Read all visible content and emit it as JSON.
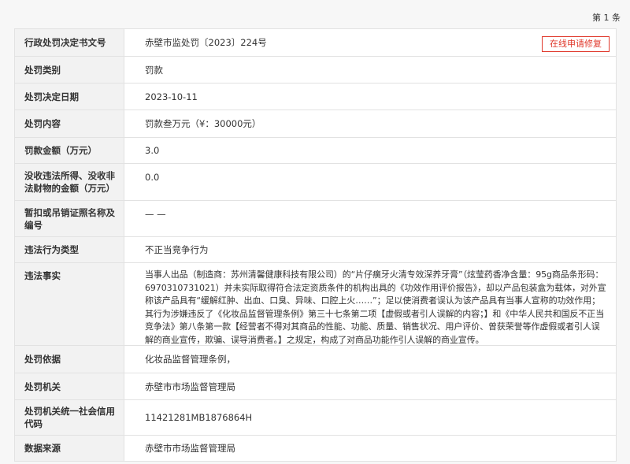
{
  "page_count": "第 1 条",
  "repair_button": "在线申请修复",
  "rows": [
    {
      "label": "行政处罚决定书文号",
      "value": "赤壁市监处罚〔2023〕224号"
    },
    {
      "label": "处罚类别",
      "value": "罚款"
    },
    {
      "label": "处罚决定日期",
      "value": "2023-10-11"
    },
    {
      "label": "处罚内容",
      "value": "罚款叁万元（¥：30000元）"
    },
    {
      "label": "罚款金额（万元）",
      "value": "3.0"
    },
    {
      "label": "没收违法所得、没收非法财物的金额（万元）",
      "value": "0.0"
    },
    {
      "label": "暂扣或吊销证照名称及编号",
      "value": "— —"
    },
    {
      "label": "违法行为类型",
      "value": "不正当竞争行为"
    },
    {
      "label": "违法事实",
      "value": "当事人出品（制造商：苏州清馨健康科技有限公司）的“片仔癀牙火清专效深养牙膏”（炫莹药香净含量：95g商品条形码：6970310731021）并未实际取得符合法定资质条件的机构出具的《功效作用评价报告》，却以产品包装盒为载体，对外宣称该产品具有“缓解红肿、出血、口臭、异味、口腔上火……”；足以使消费者误认为该产品具有当事人宣称的功效作用；其行为涉嫌违反了《化妆品监督管理条例》第三十七条第二项【虚假或者引人误解的内容；】和《中华人民共和国反不正当竞争法》第八条第一款【经营者不得对其商品的性能、功能、质量、销售状况、用户评价、曾获荣誉等作虚假或者引人误解的商业宣传，欺骗、误导消费者。】之规定，构成了对商品功能作引人误解的商业宣传。"
    },
    {
      "label": "处罚依据",
      "value": "化妆品监督管理条例，"
    },
    {
      "label": "处罚机关",
      "value": "赤壁市市场监督管理局"
    },
    {
      "label": "处罚机关统一社会信用代码",
      "value": "11421281MB1876864H"
    },
    {
      "label": "数据来源",
      "value": "赤壁市市场监督管理局"
    }
  ]
}
